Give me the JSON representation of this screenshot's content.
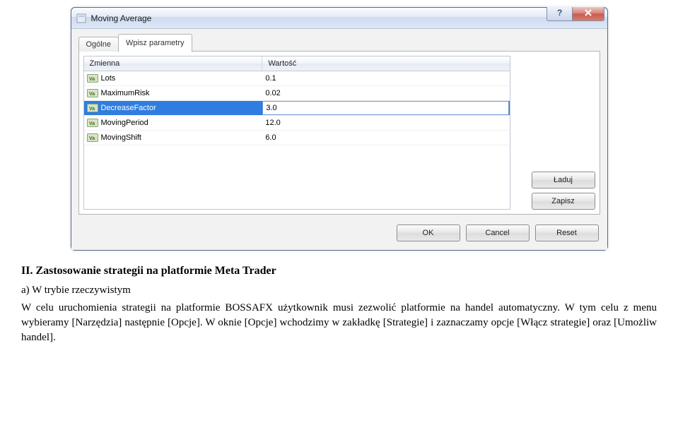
{
  "dialog": {
    "title": "Moving Average",
    "tabs": {
      "tab0": "Ogólne",
      "tab1": "Wpisz parametry"
    },
    "columns": {
      "variable": "Zmienna",
      "value": "Wartość"
    },
    "rows": {
      "r0": {
        "name": "Lots",
        "value": "0.1"
      },
      "r1": {
        "name": "MaximumRisk",
        "value": "0.02"
      },
      "r2": {
        "name": "DecreaseFactor",
        "value": "3.0"
      },
      "r3": {
        "name": "MovingPeriod",
        "value": "12.0"
      },
      "r4": {
        "name": "MovingShift",
        "value": "6.0"
      }
    },
    "buttons": {
      "load": "Ładuj",
      "save": "Zapisz",
      "ok": "OK",
      "cancel": "Cancel",
      "reset": "Reset"
    }
  },
  "doc": {
    "heading": "II. Zastosowanie strategii na platformie Meta Trader",
    "sub_a": "a) W trybie rzeczywistym",
    "para": "W celu uruchomienia strategii na platformie BOSSAFX użytkownik musi zezwolić platformie na handel automatyczny. W tym celu z menu wybieramy [Narzędzia] następnie [Opcje]. W oknie [Opcje] wchodzimy w zakładkę [Strategie] i zaznaczamy opcje [Włącz strategie] oraz [Umożliw handel]."
  }
}
